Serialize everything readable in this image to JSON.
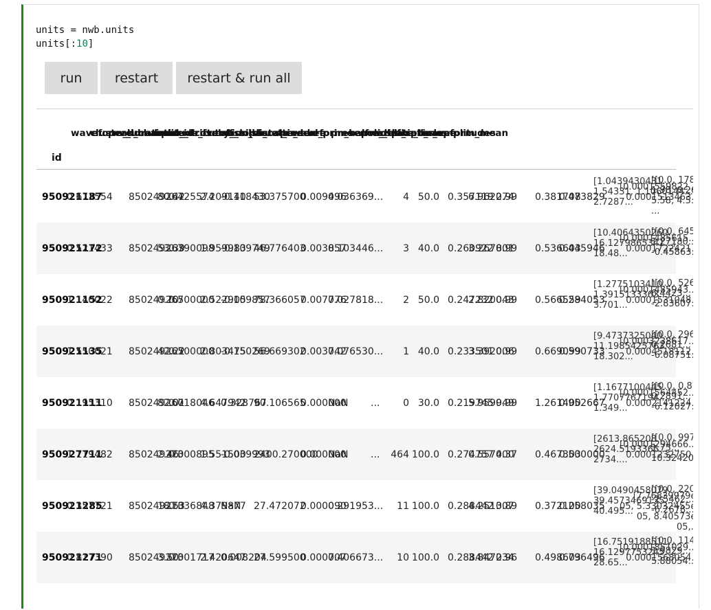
{
  "code": {
    "line1": "units = nwb.units",
    "line2_prefix": "units[:",
    "line2_num": "10",
    "line2_suffix": "]"
  },
  "buttons": {
    "run": "run",
    "restart": "restart",
    "restart_all": "restart & run all"
  },
  "table": {
    "index_name": "id",
    "headers": [
      "waveform_duration",
      "cluster_id",
      "peak_channel_id",
      "cumulative_drift",
      "amplitude_cutoff",
      "snr",
      "recovery_slope",
      "isolation_distance",
      "nn_miss_rate",
      "silhouette_score",
      "local_index",
      "spread",
      "waveform_halfwidth",
      "d_prime",
      "presence_ratio",
      "repolarization_slope",
      "nn_hit_rate",
      "spike_times",
      "spike_amplitudes",
      "waveform_mean"
    ],
    "rows": [
      {
        "id": "950921187",
        "c1": "0.673554",
        "c2": "850249267",
        "c3": "80.42",
        "c4": "0.425574",
        "c5": "2.209140",
        "c6": "-0.118430",
        "c7": "53.375700",
        "c8": "0.009496",
        "c9": "0.036369...",
        "local_index": "4",
        "spread": "50.0",
        "c12": "0.357119",
        "c13": "6.962274",
        "c14": "0.99",
        "c15": "0.381708",
        "c16": "0.473829",
        "spike_times": [
          "[1.0439430431...,",
          "1.54331, 1.1060144...,",
          "2.7287..."
        ],
        "spike_amplitudes": [
          "[0.0001559822...,",
          "0.0001513463..."
        ],
        "waveform_mean": [
          "[[0.0, 1789384...",
          "1.98, 0.26...",
          "5.58, 4.5...",
          "..."
        ]
      },
      {
        "id": "950921172",
        "c1": "0.521433",
        "c2": "850249267",
        "c3": "53.39",
        "c4": "0.390098",
        "c5": "1.959983",
        "c6": "-0.109749",
        "c7": "46.776403",
        "c8": "0.003857",
        "c9": "0.103446...",
        "local_index": "3",
        "spread": "40.0",
        "c12": "0.260922",
        "c13": "3.267801",
        "c14": "0.99",
        "c15": "0.536603",
        "c16": "0.445946",
        "spike_times": [
          "[10.4064350260...,",
          "16.1279865341...,",
          "18.48..."
        ],
        "spike_amplitudes": [
          "[0.0001485615...,",
          "0.0001722421..."
        ],
        "waveform_mean": [
          "[[0.0, 6454...",
          "1.27180...",
          "-0.45863..."
        ]
      },
      {
        "id": "950921152",
        "c1": "1.140022",
        "c2": "850249267",
        "c3": "0.70",
        "c4": "0.500000",
        "c5": "2.522905",
        "c6": "-0.109857",
        "c7": "78.366057",
        "c8": "0.007776",
        "c9": "0.027818...",
        "local_index": "2",
        "spread": "50.0",
        "c12": "0.247232",
        "c13": "2.820043",
        "c14": "0.99",
        "c15": "0.566559",
        "c16": "0.284053",
        "spike_times": [
          "[1.2775103410...,",
          "1.3915133363...,",
          "3.701..."
        ],
        "spike_amplitudes": [
          "[0.0001485943...,",
          "0.0001531048..."
        ],
        "waveform_mean": [
          "[[0.0, 5262...",
          "6.4423...",
          "-2.83607..."
        ]
      },
      {
        "id": "950921135",
        "c1": "1.550021",
        "c2": "850249267",
        "c3": "42.22",
        "c4": "0.500000",
        "c5": "2.803475",
        "c6": "-0.150269",
        "c7": "56.669302",
        "c8": "0.003742",
        "c9": "0.076530...",
        "local_index": "1",
        "spread": "40.0",
        "c12": "0.233501",
        "c13": "3.392006",
        "c14": "0.99",
        "c15": "0.669099",
        "c16": "0.590733",
        "spike_times": [
          "[9.4737325040...,",
          "11.1985425763...,",
          "18.302..."
        ],
        "spike_amplitudes": [
          "[0.0003238617...,",
          "0.0004518112..."
        ],
        "waveform_mean": [
          "[[0.0, 2962...",
          "0.2681...",
          "-6.08751..."
        ]
      },
      {
        "id": "950921111",
        "c1": "0.195310",
        "c2": "850249267",
        "c3": "82.01",
        "c4": "0.018046",
        "c5": "4.647942",
        "c6": "0.328767",
        "c7": "90.106565",
        "c8": "0.000000",
        "c9": "NaN",
        "c9b": "...",
        "local_index": "0",
        "spread": "30.0",
        "c12": "0.219745",
        "c13": "5.959949",
        "c14": "0.99",
        "c15": "1.261400",
        "c16": "0.952667",
        "spike_times": [
          "[1.1677100445...,",
          "1.7707767194...,",
          "1.349..."
        ],
        "spike_amplitudes": [
          "[0.0001564452...,",
          "0.0002141224..."
        ],
        "waveform_mean": [
          "[[0.0, 0.87950...",
          "0.2891...",
          "-6.12027..."
        ]
      },
      {
        "id": "950927711",
        "c1": "1.119482",
        "c2": "850249273",
        "c3": "2.46",
        "c4": "0.000895",
        "c5": "1.551500",
        "c6": "-0.039993",
        "c7": "2400.270000",
        "c8": "0.000000",
        "c9": "NaN",
        "c9b": "...",
        "local_index": "464",
        "spread": "100.0",
        "c12": "0.274757",
        "c13": "0.557400",
        "c14": "0.37",
        "c15": "0.467303",
        "c16": "0.500000",
        "spike_times": [
          "[2613.865208...,",
          "2624.5193365...,",
          "2734...."
        ],
        "spike_amplitudes": [
          "[0.0001294666...,",
          "0.0001232750..."
        ],
        "waveform_mean": [
          "[[0.0, 9977...",
          "1.75...",
          "10.32420..."
        ]
      },
      {
        "id": "950921285",
        "c1": "0.357721",
        "c2": "850249273",
        "c3": "18.53",
        "c4": "0.036848",
        "c5": "4.379877",
        "c6": "NaN",
        "c7": "27.472072",
        "c8": "0.000090",
        "c9": "0.291953...",
        "local_index": "11",
        "spread": "100.0",
        "c12": "0.288442",
        "c13": "4.251307",
        "c14": "0.89",
        "c15": "0.372100",
        "c16": "0.258035",
        "spike_times": [
          "[39.0490458079...,",
          "39.4573469135...,",
          "40.495..."
        ],
        "spike_amplitudes": [
          "[7.76839979e-",
          "05, 5.33032455e-",
          "05, 8.40573e-",
          "05,..."
        ],
        "waveform_mean": [
          "[[0.0, 2200...",
          "-2.5462...",
          "-6.2678..."
        ]
      },
      {
        "id": "950921271",
        "c1": "0.817390",
        "c2": "850249273",
        "c3": "3.50",
        "c4": "0.001717",
        "c5": "2.420647",
        "c6": "0.008204",
        "c7": "27.599500",
        "c8": "0.000707",
        "c9": "0.406673...",
        "local_index": "10",
        "spread": "100.0",
        "c12": "0.288442",
        "c13": "3.847234",
        "c14": "0.96",
        "c15": "0.498603",
        "c16": "0.796496",
        "spike_times": [
          "[16.7519188511...,",
          "16.1297753245...,",
          "28.65..."
        ],
        "spike_amplitudes": [
          "[0.0001851029...,",
          "0.0001568054..."
        ],
        "waveform_mean": [
          "[[0.0, 114475...",
          "1.9829...",
          "5.88054..."
        ]
      }
    ]
  }
}
